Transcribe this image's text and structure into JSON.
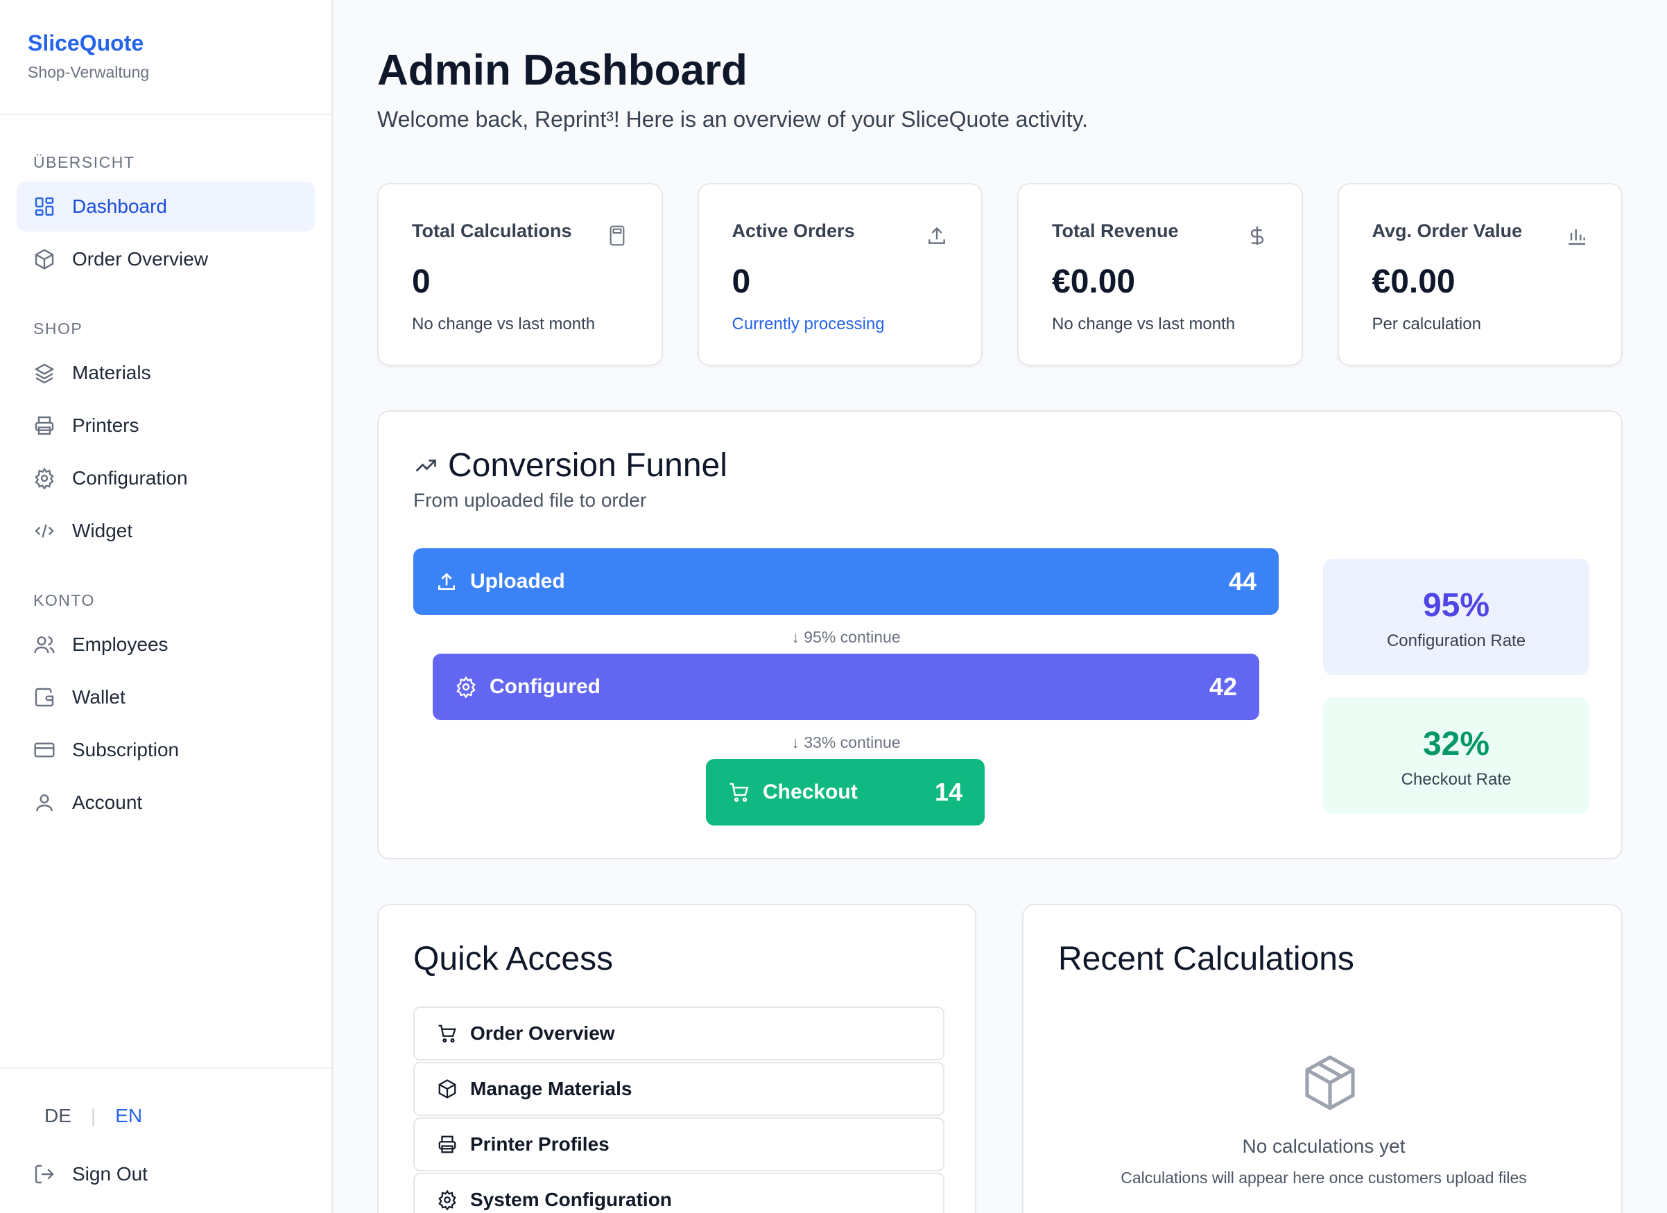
{
  "brand": {
    "name": "SliceQuote",
    "subtitle": "Shop-Verwaltung"
  },
  "sidebar": {
    "sections": [
      {
        "label": "ÜBERSICHT",
        "items": [
          {
            "label": "Dashboard",
            "icon": "grid-icon",
            "active": true
          },
          {
            "label": "Order Overview",
            "icon": "package-icon"
          }
        ]
      },
      {
        "label": "SHOP",
        "items": [
          {
            "label": "Materials",
            "icon": "layers-icon"
          },
          {
            "label": "Printers",
            "icon": "printer-icon"
          },
          {
            "label": "Configuration",
            "icon": "gear-icon"
          },
          {
            "label": "Widget",
            "icon": "code-icon"
          }
        ]
      },
      {
        "label": "KONTO",
        "items": [
          {
            "label": "Employees",
            "icon": "users-icon"
          },
          {
            "label": "Wallet",
            "icon": "wallet-icon"
          },
          {
            "label": "Subscription",
            "icon": "credit-card-icon"
          },
          {
            "label": "Account",
            "icon": "user-icon"
          }
        ]
      }
    ],
    "lang": {
      "de": "DE",
      "sep": "|",
      "en": "EN"
    },
    "signout": "Sign Out"
  },
  "header": {
    "title": "Admin Dashboard",
    "subtitle": "Welcome back, Reprint³! Here is an overview of your SliceQuote activity."
  },
  "stats": [
    {
      "label": "Total Calculations",
      "value": "0",
      "note": "No change vs last month",
      "icon": "calculator-icon"
    },
    {
      "label": "Active Orders",
      "value": "0",
      "note": "Currently processing",
      "icon": "upload-icon"
    },
    {
      "label": "Total Revenue",
      "value": "€0.00",
      "note": "No change vs last month",
      "icon": "dollar-icon"
    },
    {
      "label": "Avg. Order Value",
      "value": "€0.00",
      "note": "Per calculation",
      "icon": "bar-chart-icon"
    }
  ],
  "funnel": {
    "title": "Conversion Funnel",
    "subtitle": "From uploaded file to order",
    "stages": [
      {
        "label": "Uploaded",
        "count": "44"
      },
      {
        "label": "Configured",
        "count": "42"
      },
      {
        "label": "Checkout",
        "count": "14"
      }
    ],
    "continue": [
      "↓ 95% continue",
      "↓ 33% continue"
    ],
    "rates": [
      {
        "value": "95%",
        "label": "Configuration Rate",
        "color": "#4f46e5"
      },
      {
        "value": "32%",
        "label": "Checkout Rate",
        "color": "#059669"
      }
    ],
    "colors": {
      "uploaded": "#3b82f6",
      "configured": "#6366f1",
      "checkout": "#10b981"
    }
  },
  "quick_access": {
    "title": "Quick Access",
    "items": [
      "Order Overview",
      "Manage Materials",
      "Printer Profiles",
      "System Configuration"
    ]
  },
  "recent": {
    "title": "Recent Calculations",
    "empty_title": "No calculations yet",
    "empty_sub": "Calculations will appear here once customers upload files"
  }
}
